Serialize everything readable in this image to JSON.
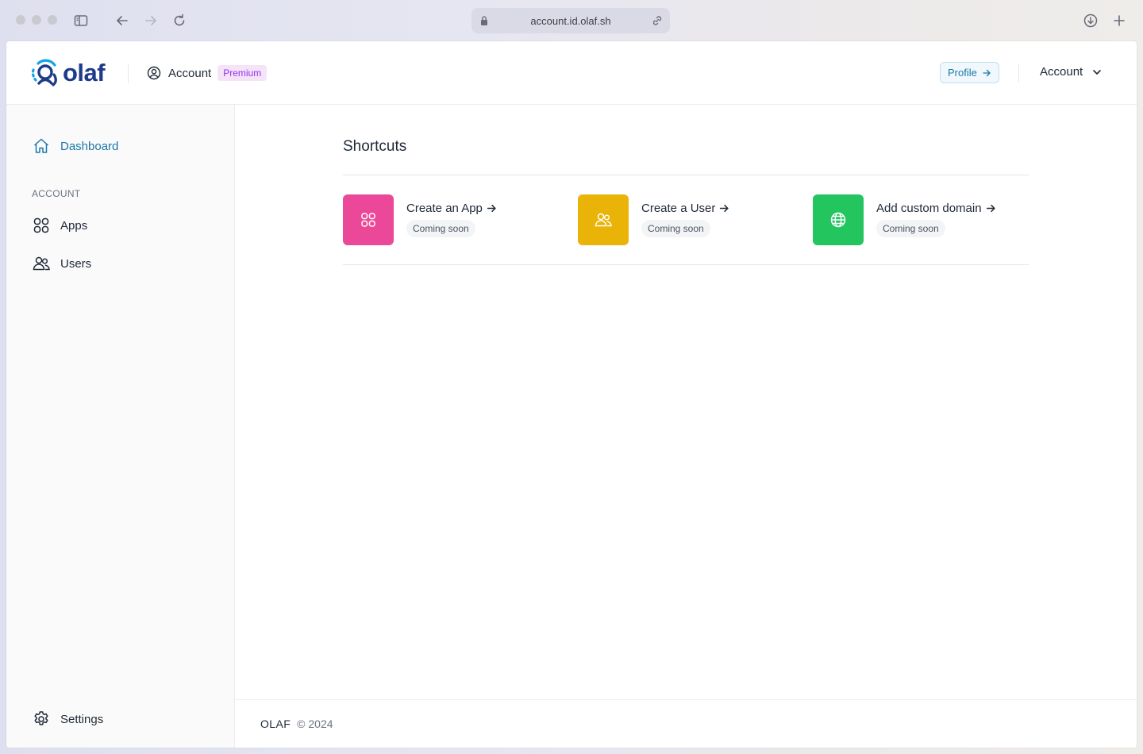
{
  "browser": {
    "url": "account.id.olaf.sh"
  },
  "header": {
    "logo_text": "olaf",
    "section_label": "Account",
    "badge": "Premium",
    "profile_button": "Profile",
    "account_menu": "Account"
  },
  "sidebar": {
    "dashboard": "Dashboard",
    "section_account": "ACCOUNT",
    "apps": "Apps",
    "users": "Users",
    "settings": "Settings"
  },
  "main": {
    "heading": "Shortcuts",
    "shortcuts": [
      {
        "title": "Create an App",
        "status": "Coming soon",
        "color": "#ec4899",
        "icon": "grid-icon"
      },
      {
        "title": "Create a User",
        "status": "Coming soon",
        "color": "#eab308",
        "icon": "users-icon"
      },
      {
        "title": "Add custom domain",
        "status": "Coming soon",
        "color": "#22c55e",
        "icon": "globe-icon"
      }
    ]
  },
  "footer": {
    "brand": "OLAF",
    "copyright": "© 2024"
  },
  "colors": {
    "accent": "#1d78a6",
    "logo": "#1e3a8a",
    "badge_text": "#9333ea"
  }
}
